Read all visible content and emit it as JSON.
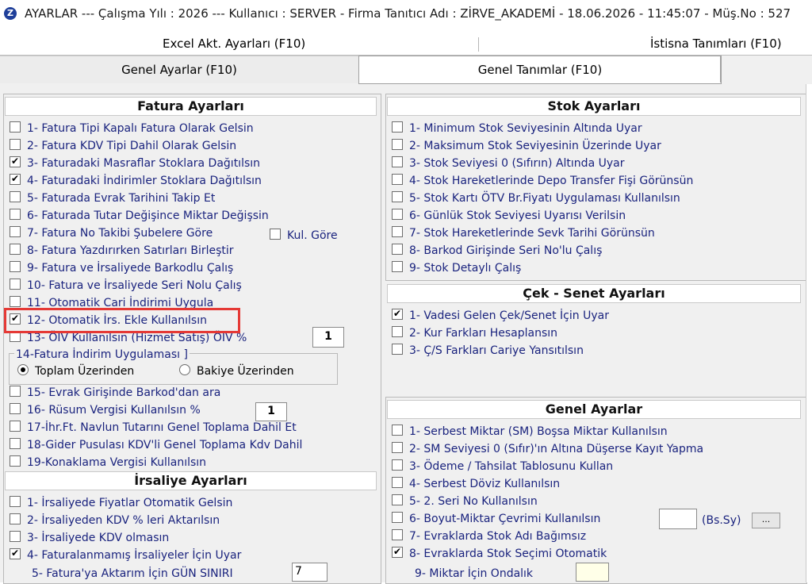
{
  "titlebar": {
    "icon": "Z",
    "text": "AYARLAR  ---  Çalışma Yılı : 2026  ---  Kullanıcı : SERVER - Firma Tanıtıcı Adı : ZİRVE_AKADEMİ - 18.06.2026 - 11:45:07 - Müş.No : 527"
  },
  "top_tabs": [
    "Excel Akt. Ayarları (F10)",
    "İstisna Tanımları (F10)"
  ],
  "tabs": [
    "Genel Ayarlar (F10)",
    "Genel Tanımlar (F10)"
  ],
  "fatura": {
    "title": "Fatura Ayarları",
    "items": [
      {
        "label": "1- Fatura Tipi Kapalı Fatura Olarak Gelsin",
        "checked": false
      },
      {
        "label": "2- Fatura KDV Tipi Dahil Olarak Gelsin",
        "checked": false
      },
      {
        "label": "3- Faturadaki Masraflar Stoklara Dağıtılsın",
        "checked": true
      },
      {
        "label": "4- Faturadaki İndirimler Stoklara Dağıtılsın",
        "checked": true
      },
      {
        "label": "5- Faturada Evrak Tarihini Takip Et",
        "checked": false
      },
      {
        "label": "6- Faturada Tutar Değişince Miktar Değişsin",
        "checked": false
      },
      {
        "label": "7- Fatura No Takibi Şubelere Göre",
        "checked": false
      },
      {
        "label": "8- Fatura Yazdırırken Satırları Birleştir",
        "checked": false
      },
      {
        "label": "9- Fatura ve İrsaliyede Barkodlu Çalış",
        "checked": false
      },
      {
        "label": "10- Fatura ve İrsaliyede Seri Nolu Çalış",
        "checked": false
      },
      {
        "label": "11- Otomatik Cari İndirimi Uygula",
        "checked": false
      },
      {
        "label": "12- Otomatik İrs. Ekle Kullanılsın",
        "checked": true
      },
      {
        "label": "13- ÖİV Kullanılsın (Hizmet Satış) ÖİV %",
        "checked": false
      }
    ],
    "kul_gore": "Kul. Göre",
    "oiv_value": "1",
    "group_title": "14-Fatura İndirim Uygulaması ]",
    "radio_toplam": "Toplam Üzerinden",
    "radio_bakiye": "Bakiye Üzerinden",
    "items2": [
      {
        "label": "15- Evrak Girişinde Barkod'dan ara",
        "checked": false
      },
      {
        "label": "16- Rüsum Vergisi Kullanılsın %",
        "checked": false
      },
      {
        "label": "17-İhr.Ft. Navlun Tutarını Genel Toplama Dahil Et",
        "checked": false
      },
      {
        "label": "18-Gider Pusulası KDV'li Genel Toplama Kdv Dahil",
        "checked": false
      },
      {
        "label": "19-Konaklama Vergisi Kullanılsın",
        "checked": false
      }
    ],
    "rusum_value": "1"
  },
  "irsaliye": {
    "title": "İrsaliye Ayarları",
    "items": [
      {
        "label": "1- İrsaliyede Fiyatlar Otomatik Gelsin",
        "checked": false
      },
      {
        "label": "2- İrsaliyeden KDV % leri Aktarılsın",
        "checked": false
      },
      {
        "label": "3- İrsaliyede KDV olmasın",
        "checked": false
      },
      {
        "label": "4- Faturalanmamış İrsaliyeler İçin Uyar",
        "checked": true
      }
    ],
    "gun_label": "5- Fatura'ya Aktarım İçin GÜN SINIRI",
    "gun_value": "7"
  },
  "stok": {
    "title": "Stok Ayarları",
    "items": [
      {
        "label": "1- Minimum Stok Seviyesinin Altında Uyar",
        "checked": false
      },
      {
        "label": "2- Maksimum Stok Seviyesinin Üzerinde Uyar",
        "checked": false
      },
      {
        "label": "3- Stok Seviyesi 0 (Sıfırın) Altında Uyar",
        "checked": false
      },
      {
        "label": "4- Stok Hareketlerinde Depo Transfer Fişi Görünsün",
        "checked": false
      },
      {
        "label": "5- Stok Kartı ÖTV Br.Fiyatı Uygulaması Kullanılsın",
        "checked": false
      },
      {
        "label": "6- Günlük Stok Seviyesi Uyarısı Verilsin",
        "checked": false
      },
      {
        "label": "7- Stok Hareketlerinde Sevk Tarihi Görünsün",
        "checked": false
      },
      {
        "label": "8- Barkod Girişinde Seri No'lu Çalış",
        "checked": false
      },
      {
        "label": "9- Stok Detaylı Çalış",
        "checked": false
      }
    ]
  },
  "cek": {
    "title": "Çek - Senet Ayarları",
    "items": [
      {
        "label": "1- Vadesi Gelen Çek/Senet İçin Uyar",
        "checked": true
      },
      {
        "label": "2- Kur Farkları Hesaplansın",
        "checked": false
      },
      {
        "label": "3- Ç/S Farkları Cariye Yansıtılsın",
        "checked": false
      }
    ]
  },
  "genel": {
    "title": "Genel Ayarlar",
    "items": [
      {
        "label": "1- Serbest Miktar (SM) Boşsa Miktar Kullanılsın",
        "checked": false
      },
      {
        "label": "2- SM Seviyesi 0 (Sıfır)'ın Altına Düşerse Kayıt Yapma",
        "checked": false
      },
      {
        "label": "3- Ödeme / Tahsilat Tablosunu Kullan",
        "checked": false
      },
      {
        "label": "4- Serbest Döviz Kullanılsın",
        "checked": false
      },
      {
        "label": "5- 2. Seri No Kullanılsın",
        "checked": false
      },
      {
        "label": "6- Boyut-Miktar Çevrimi Kullanılsın",
        "checked": false
      },
      {
        "label": "7- Evraklarda Stok Adı Bağımsız",
        "checked": false
      },
      {
        "label": "8- Evraklarda Stok Seçimi Otomatik",
        "checked": true
      }
    ],
    "bssy_label": "(Bs.Sy)",
    "dots_label": "...",
    "ondalik_label": "9- Miktar İçin Ondalık"
  }
}
